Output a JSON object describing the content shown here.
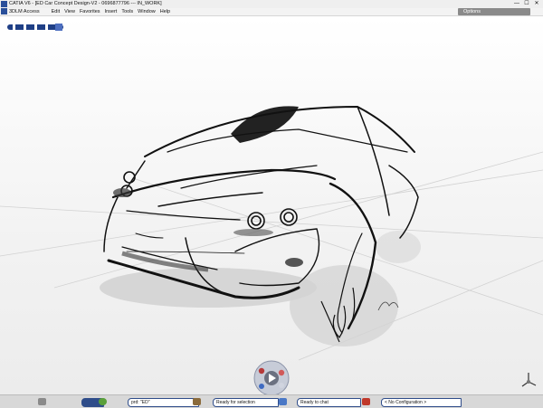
{
  "window": {
    "title": "CATIA V6 - [ED Car Concept Design-V2 - 0696877796 --- IN_WORK]",
    "controls": [
      "—",
      "☐",
      "✕"
    ]
  },
  "menu": {
    "items": [
      "3DLM Access",
      "Edit",
      "View",
      "Favorites",
      "Insert",
      "Tools",
      "Window",
      "Help"
    ]
  },
  "toolbar": {
    "options_label": "Options"
  },
  "status": {
    "product_field": "prd: \"ED\"",
    "selection_status": "Ready for selection",
    "chat_status": "Ready to chat",
    "configuration": "< No Configuration >"
  },
  "colors": {
    "accent": "#2f4d8a",
    "red": "#c0392b",
    "green": "#5aa03a"
  },
  "icons": [
    "compass-icon",
    "play-icon",
    "axis-icon",
    "search-icon",
    "chat-icon",
    "config-icon"
  ]
}
